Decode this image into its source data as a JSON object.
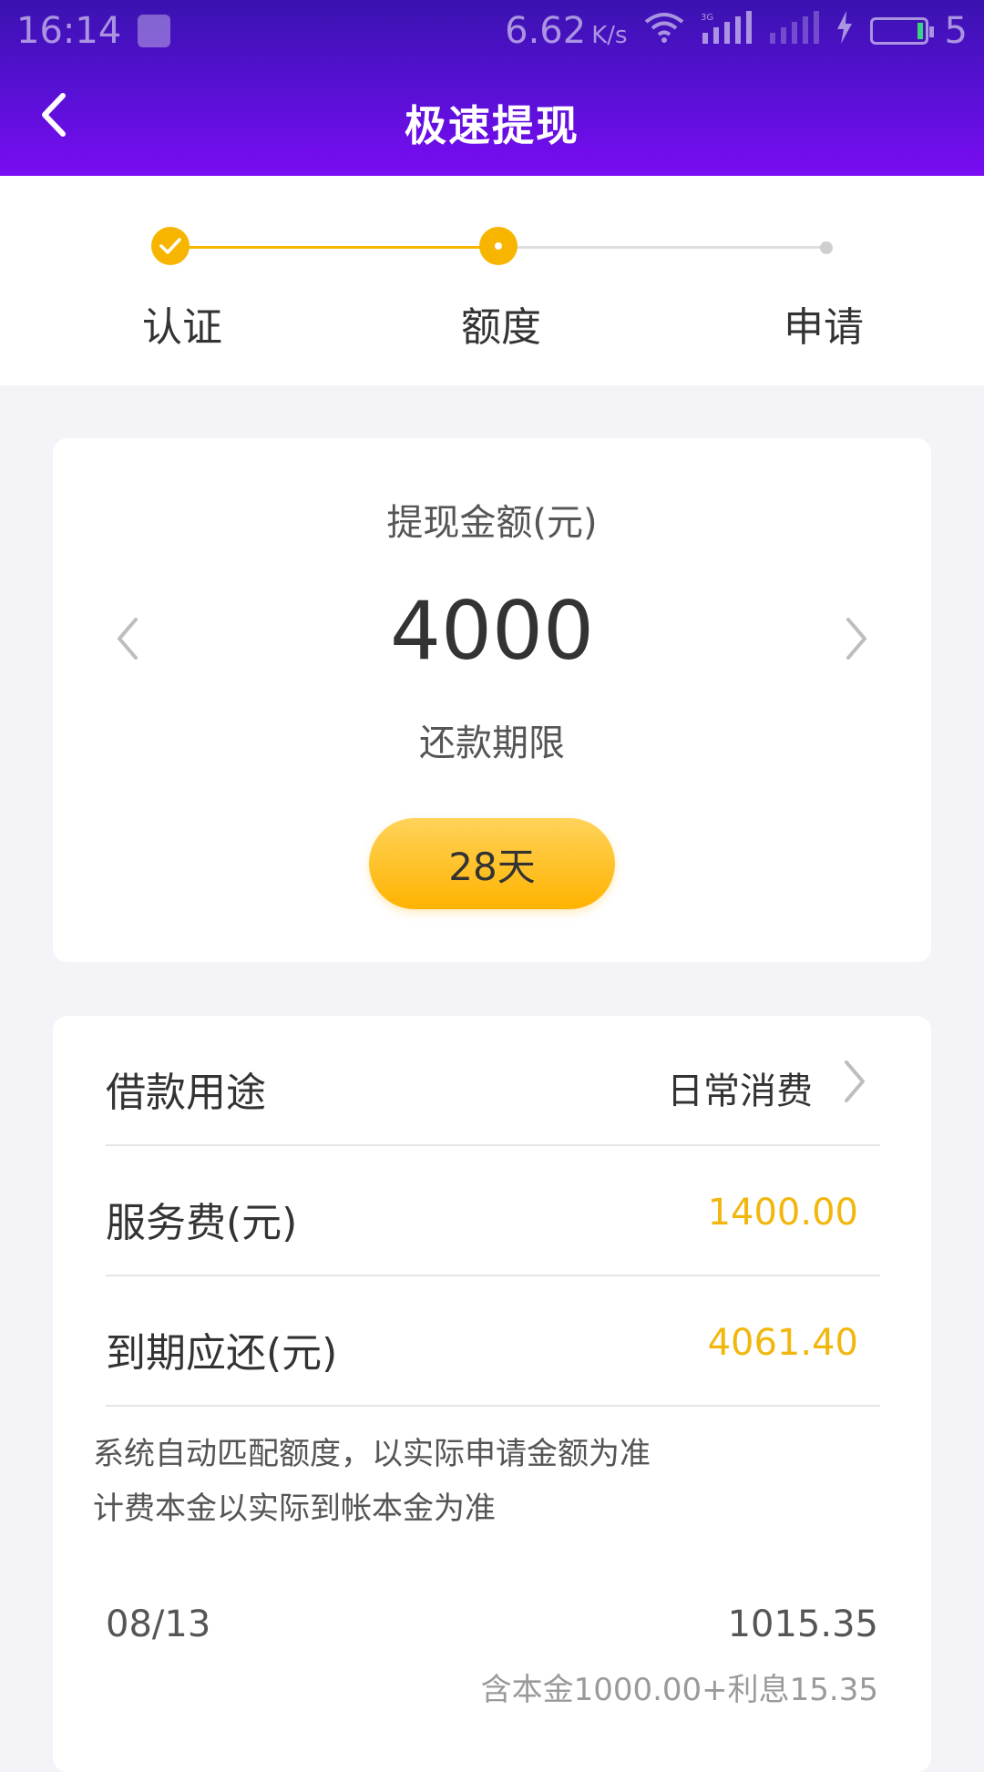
{
  "status_bar": {
    "time": "16:14",
    "net_speed": "6.62",
    "net_unit": "K/s",
    "network_label": "3G",
    "battery_level": "5"
  },
  "header": {
    "title": "极速提现"
  },
  "stepper": {
    "steps": [
      {
        "label": "认证",
        "state": "done"
      },
      {
        "label": "额度",
        "state": "current"
      },
      {
        "label": "申请",
        "state": "pending"
      }
    ]
  },
  "amount_card": {
    "label": "提现金额(元)",
    "value": "4000",
    "term_label": "还款期限",
    "term_value": "28天"
  },
  "details": {
    "purpose_label": "借款用途",
    "purpose_value": "日常消费",
    "fee_label": "服务费(元)",
    "fee_value": "1400.00",
    "due_label": "到期应还(元)",
    "due_value": "4061.40",
    "note_line1": "系统自动匹配额度，以实际申请金额为准",
    "note_line2": "计费本金以实际到帐本金为准"
  },
  "repayment_plan": {
    "date": "08/13",
    "total": "1015.35",
    "detail": "含本金1000.00+利息15.35"
  },
  "colors": {
    "header_gradient_start": "#3a12b0",
    "header_gradient_end": "#7a0cf3",
    "accent_gold": "#f7b500",
    "value_gold": "#f1b70f",
    "page_background": "#f4f4f8"
  }
}
